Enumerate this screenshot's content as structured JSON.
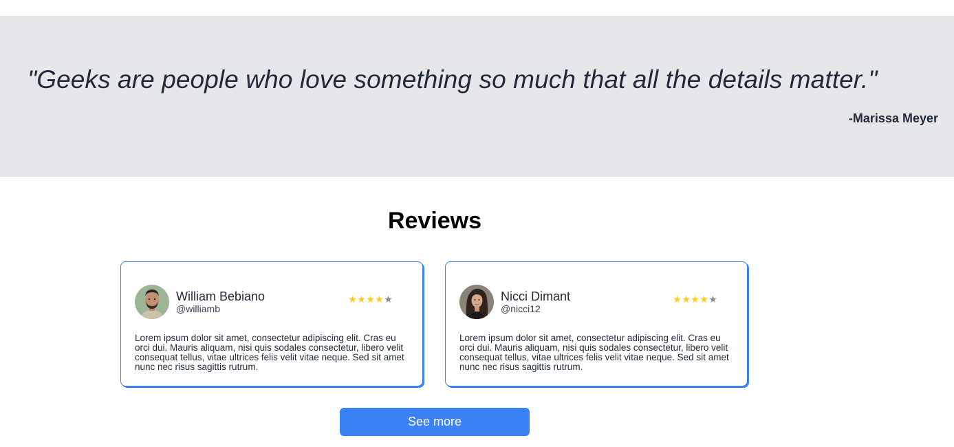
{
  "quote": {
    "text": "\"Geeks are people who love something so much that all the details matter.\"",
    "author": "-Marissa Meyer",
    "background_color": "#e5e7eb"
  },
  "reviews": {
    "title": "Reviews",
    "accent_color": "#3b82f6",
    "items": [
      {
        "name": "William Bebiano",
        "handle": "@williamb",
        "rating": 4,
        "max_rating": 5,
        "stars": [
          "★",
          "★",
          "★",
          "★",
          "★"
        ],
        "avatar_icon": "man-portrait-avatar",
        "text": "Lorem ipsum dolor sit amet, consectetur adipiscing elit. Cras eu orci dui. Mauris aliquam, nisi quis sodales consectetur, libero velit consequat tellus, vitae ultrices felis velit vitae neque. Sed sit amet nunc nec risus sagittis rutrum."
      },
      {
        "name": "Nicci Dimant",
        "handle": "@nicci12",
        "rating": 4,
        "max_rating": 5,
        "stars": [
          "★",
          "★",
          "★",
          "★",
          "★"
        ],
        "avatar_icon": "woman-portrait-avatar",
        "text": "Lorem ipsum dolor sit amet, consectetur adipiscing elit. Cras eu orci dui. Mauris aliquam, nisi quis sodales consectetur, libero velit consequat tellus, vitae ultrices felis velit vitae neque. Sed sit amet nunc nec risus sagittis rutrum."
      }
    ],
    "star_filled_color": "#facc15",
    "star_empty_color": "#8b8b8b"
  },
  "see_more": {
    "label": "See more",
    "color": "#3b82f6"
  }
}
